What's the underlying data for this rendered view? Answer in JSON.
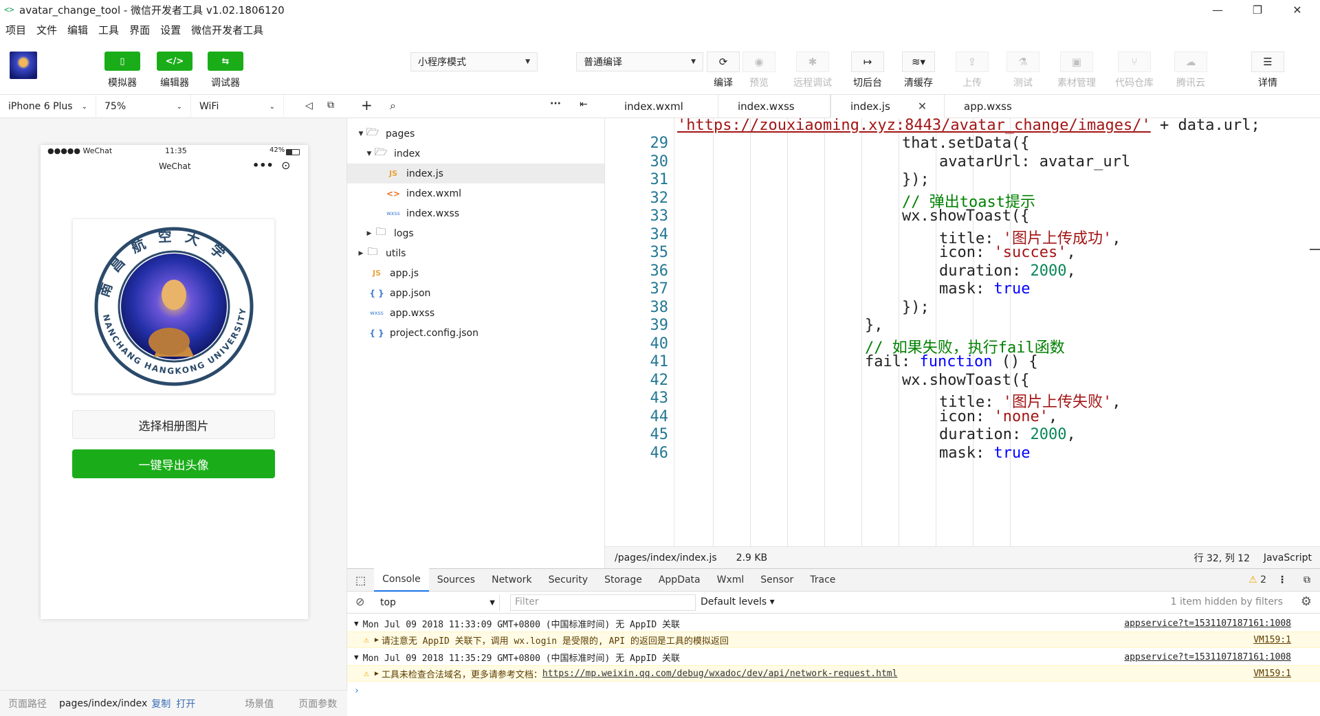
{
  "window": {
    "icon": "<>",
    "title": "avatar_change_tool - 微信开发者工具 v1.02.1806120",
    "minimize": "—",
    "maximize": "❐",
    "close": "✕"
  },
  "menu": [
    "项目",
    "文件",
    "编辑",
    "工具",
    "界面",
    "设置",
    "微信开发者工具"
  ],
  "toolbar": {
    "simulator_label": "模拟器",
    "editor_label": "编辑器",
    "debugger_label": "调试器",
    "simulator_icon": "▯",
    "editor_icon": "</>",
    "debugger_icon": "⇆",
    "mode_select": "小程序模式",
    "compile_select": "普通编译",
    "compile_label": "编译",
    "preview_label": "预览",
    "remote_debug_label": "远程调试",
    "background_label": "切后台",
    "clear_cache_label": "清缓存",
    "upload_label": "上传",
    "test_label": "测试",
    "assets_label": "素材管理",
    "repo_label": "代码仓库",
    "tencent_cloud_label": "腾讯云",
    "details_label": "详情"
  },
  "device_bar": {
    "device": "iPhone 6 Plus",
    "zoom": "75%",
    "network": "WiFi"
  },
  "phone": {
    "signal": "●●●●● WeChat",
    "time": "11:35",
    "battery": "42%",
    "nav_title": "WeChat",
    "more": "•••",
    "pick_button": "选择相册图片",
    "export_button": "一键导出头像",
    "badge_text_top": "南昌航空大学",
    "badge_text_bottom": "NANCHANG HANGKONG UNIVERSITY"
  },
  "path_bar": {
    "label": "页面路径",
    "path": "pages/index/index",
    "copy": "复制",
    "open": "打开",
    "scene": "场景值",
    "params": "页面参数"
  },
  "file_tree": [
    {
      "name": "pages",
      "type": "folder",
      "depth": 0,
      "expanded": true
    },
    {
      "name": "index",
      "type": "folder",
      "depth": 1,
      "expanded": true
    },
    {
      "name": "index.js",
      "type": "js",
      "depth": 2,
      "selected": true
    },
    {
      "name": "index.wxml",
      "type": "wxml",
      "depth": 2
    },
    {
      "name": "index.wxss",
      "type": "wxss",
      "depth": 2
    },
    {
      "name": "logs",
      "type": "folder",
      "depth": 1,
      "expanded": false
    },
    {
      "name": "utils",
      "type": "folder",
      "depth": 0,
      "expanded": false
    },
    {
      "name": "app.js",
      "type": "js",
      "depth": 0
    },
    {
      "name": "app.json",
      "type": "json",
      "depth": 0
    },
    {
      "name": "app.wxss",
      "type": "wxss",
      "depth": 0
    },
    {
      "name": "project.config.json",
      "type": "json",
      "depth": 0
    }
  ],
  "editor_tabs": [
    "index.wxml",
    "index.wxss",
    "index.js",
    "app.wxss"
  ],
  "active_tab": "index.js",
  "code": {
    "first_line_url": "'https://zouxiaoming.xyz:8443/avatar_change/images/'",
    "first_line_rest": " + data.url;",
    "line_numbers": [
      "29",
      "30",
      "31",
      "32",
      "33",
      "34",
      "35",
      "36",
      "37",
      "38",
      "39",
      "40",
      "41",
      "42",
      "43",
      "44",
      "45",
      "46"
    ],
    "l29": "that.setData({",
    "l30": "avatarUrl: avatar_url",
    "l31": "});",
    "l32": "// 弹出toast提示",
    "l33": "wx.showToast({",
    "l34a": "title: ",
    "l34b": "'图片上传成功'",
    "l34c": ",",
    "l35a": "icon: ",
    "l35b": "'succes'",
    "l35c": ",",
    "l36a": "duration: ",
    "l36b": "2000",
    "l36c": ",",
    "l37a": "mask: ",
    "l37b": "true",
    "l38": "});",
    "l39": "},",
    "l40": "// 如果失败，执行fail函数",
    "l41a": "fail: ",
    "l41b": "function",
    "l41c": " () {",
    "l42": "wx.showToast({",
    "l43a": "title: ",
    "l43b": "'图片上传失败'",
    "l43c": ",",
    "l44a": "icon: ",
    "l44b": "'none'",
    "l44c": ",",
    "l45a": "duration: ",
    "l45b": "2000",
    "l45c": ",",
    "l46a": "mask: ",
    "l46b": "true"
  },
  "editor_status": {
    "path": "/pages/index/index.js",
    "size": "2.9 KB",
    "cursor": "行 32, 列 12",
    "language": "JavaScript"
  },
  "devtools_tabs": [
    "Console",
    "Sources",
    "Network",
    "Security",
    "Storage",
    "AppData",
    "Wxml",
    "Sensor",
    "Trace"
  ],
  "warning_count": "2",
  "console_filter": {
    "context": "top",
    "filter_placeholder": "Filter",
    "levels": "Default levels",
    "hidden": "1 item hidden by filters"
  },
  "console_rows": [
    {
      "text": "Mon Jul 09 2018 11:33:09 GMT+0800 (中国标准时间) 无 AppID 关联",
      "src": "appservice?t=1531107187161:1008"
    },
    {
      "text": "请注意无 AppID 关联下，调用 wx.login 是受限的, API 的返回是工具的模拟返回",
      "src": "VM159:1"
    },
    {
      "text": "Mon Jul 09 2018 11:35:29 GMT+0800 (中国标准时间) 无 AppID 关联",
      "src": "appservice?t=1531107187161:1008"
    },
    {
      "text": "工具未检查合法域名，更多请参考文档：",
      "link": "https://mp.weixin.qq.com/debug/wxadoc/dev/api/network-request.html",
      "src": "VM159:1"
    }
  ],
  "colors": {
    "accent_green": "#1aad19",
    "line_number": "#237893",
    "string": "#a31515",
    "comment": "#008000",
    "keyword": "#0000ff",
    "warning_bg": "#fffbe5"
  }
}
